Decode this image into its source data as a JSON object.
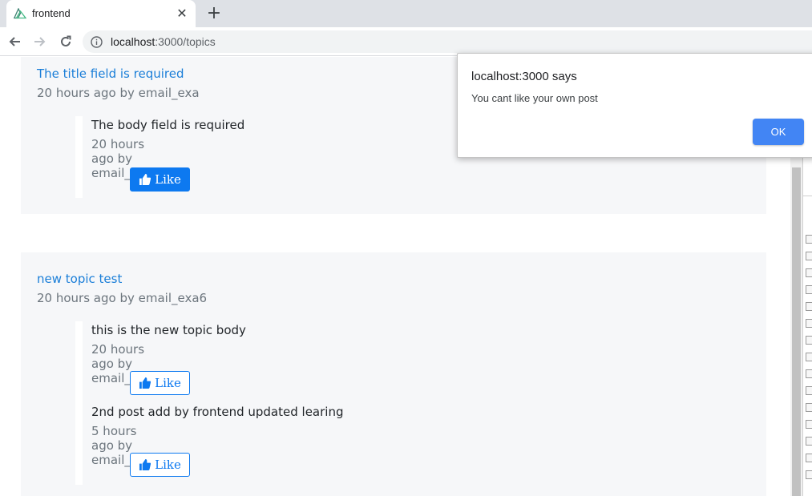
{
  "browser": {
    "tab_title": "frontend",
    "url_host": "localhost",
    "url_rest": ":3000/topics",
    "accent_color": "#1a73e8"
  },
  "topics": [
    {
      "title": "The title field is required",
      "meta": "20 hours ago by email_exa",
      "posts": [
        {
          "body": "The body field is required",
          "meta": "20 hours ago by email_exa",
          "like_label": "Like"
        }
      ]
    },
    {
      "title": "new topic test",
      "meta": "20 hours ago by email_exa6",
      "posts": [
        {
          "body": "this is the new topic body",
          "meta": "20 hours ago by email_exa6",
          "like_label": "Like"
        },
        {
          "body": "2nd post add by frontend updated learing",
          "meta": "5 hours ago by email_exa",
          "like_label": "Like"
        }
      ]
    }
  ],
  "dialog": {
    "title": "localhost:3000 says",
    "message": "You cant like your own post",
    "ok_label": "OK"
  },
  "colors": {
    "link": "#1a7ed8",
    "like_button": "#0d79f0",
    "dialog_ok": "#4285f4"
  }
}
